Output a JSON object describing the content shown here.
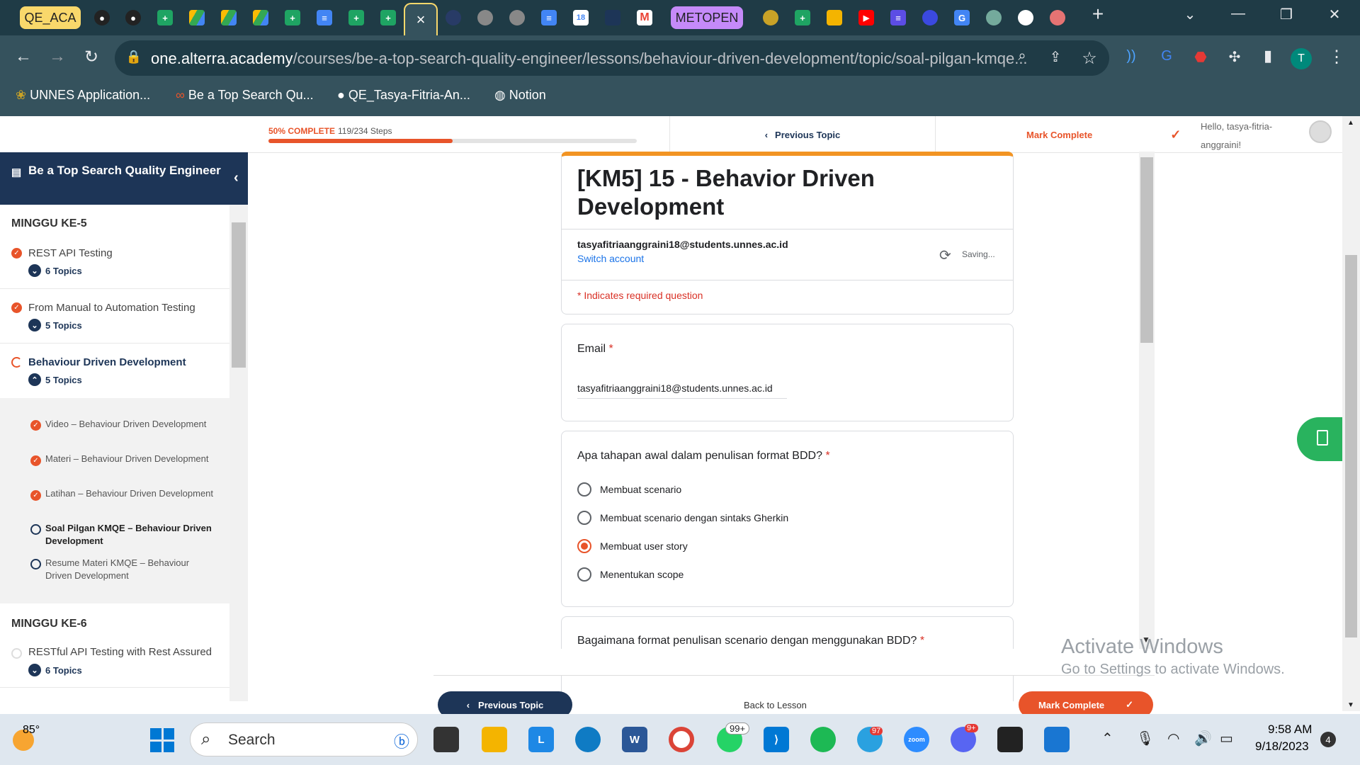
{
  "browser": {
    "tab_group_1": "QE_ACA",
    "tab_group_2": "METOPEN",
    "active_tab_icon": "close-icon",
    "url_domain": "one.alterra.academy",
    "url_path": "/courses/be-a-top-search-quality-engineer/lessons/behaviour-driven-development/topic/soal-pilgan-kmqe...",
    "profile_initial": "T",
    "bookmarks": [
      "UNNES Application...",
      "Be a Top Search Qu...",
      "QE_Tasya-Fitria-An...",
      "Notion"
    ]
  },
  "topbar": {
    "progress_label": "50% COMPLETE",
    "progress_steps": "119/234 Steps",
    "progress_fraction": 0.5,
    "prev_topic": "Previous Topic",
    "mark_complete": "Mark Complete",
    "greeting": "Hello, tasya-fitria-anggraini!"
  },
  "sidebar": {
    "course_title": "Be a Top Search Quality Engineer",
    "weeks": [
      {
        "label": "MINGGU KE-5",
        "lessons": [
          {
            "title": "REST API Testing",
            "topics": "6 Topics"
          },
          {
            "title": "From Manual to Automation Testing",
            "topics": "5 Topics"
          },
          {
            "title": "Behaviour Driven Development",
            "topics": "5 Topics"
          }
        ]
      },
      {
        "label": "MINGGU KE-6",
        "lessons": [
          {
            "title": "RESTful API Testing with Rest Assured",
            "topics": "6 Topics"
          }
        ]
      }
    ],
    "topic_items": [
      "Video – Behaviour Driven Development",
      "Materi – Behaviour Driven Development",
      "Latihan – Behaviour Driven Development",
      "Soal Pilgan KMQE – Behaviour Driven Development",
      "Resume Materi KMQE – Behaviour Driven Development"
    ]
  },
  "form": {
    "title": "[KM5] 15 - Behavior Driven Development",
    "account_email": "tasyafitriaanggraini18@students.unnes.ac.id",
    "switch_account": "Switch account",
    "saving": "Saving...",
    "required_note": "* Indicates required question",
    "email_label": "Email",
    "email_value": "tasyafitriaanggraini18@students.unnes.ac.id",
    "q1": {
      "text": "Apa tahapan awal dalam penulisan format BDD?",
      "options": [
        "Membuat scenario",
        "Membuat scenario dengan sintaks Gherkin",
        "Membuat user story",
        "Menentukan scope"
      ],
      "selected": "Membuat user story"
    },
    "q2": {
      "text": "Bagaimana format penulisan scenario dengan menggunakan BDD?"
    },
    "asterisk": "*"
  },
  "bottomnav": {
    "prev": "Previous Topic",
    "back": "Back to Lesson",
    "complete": "Mark Complete"
  },
  "watermark": {
    "line1": "Activate Windows",
    "line2": "Go to Settings to activate Windows."
  },
  "taskbar": {
    "weather": "85°",
    "search_placeholder": "Search",
    "whatsapp_badge": "99+",
    "telegram_badge": "97",
    "discord_badge": "9+",
    "time": "9:58 AM",
    "date": "9/18/2023",
    "notification_count": "4"
  },
  "colors": {
    "brand_navy": "#1d3557",
    "brand_orange": "#e8542a",
    "form_accent": "#f29423"
  }
}
